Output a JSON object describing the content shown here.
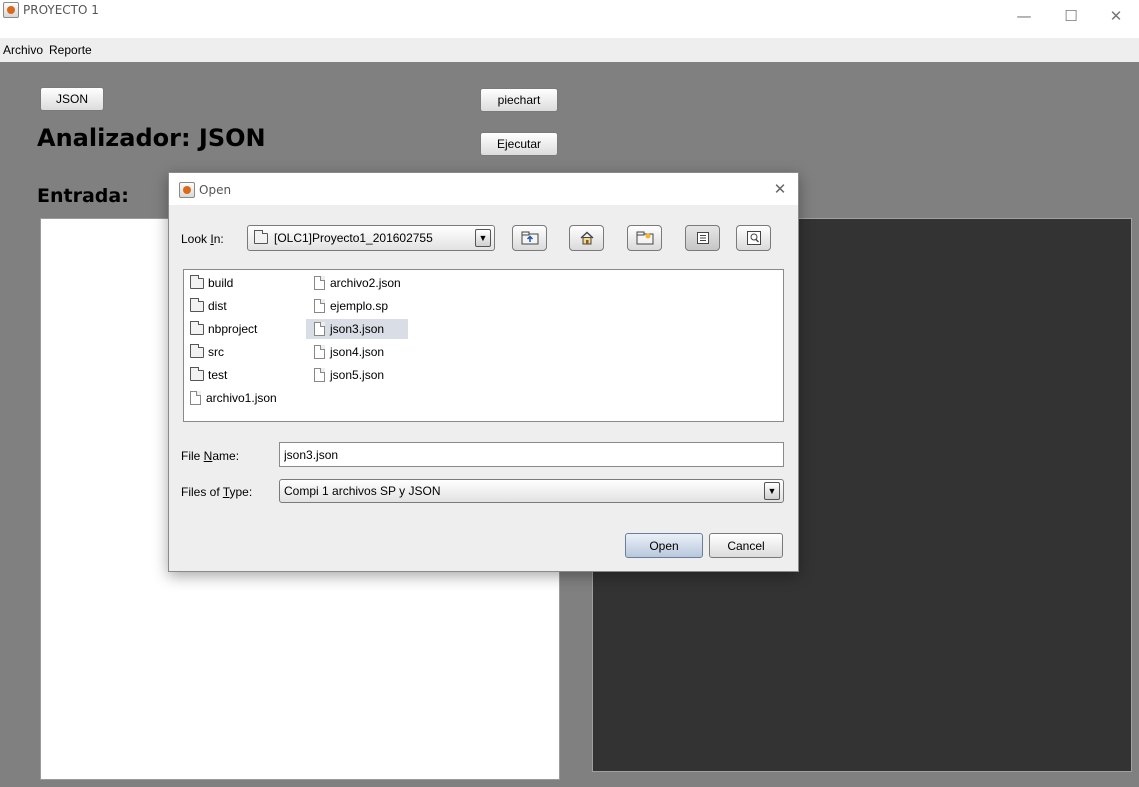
{
  "window": {
    "title": "PROYECTO 1",
    "controls": {
      "minimize": "—",
      "maximize": "☐",
      "close": "✕"
    }
  },
  "menubar": {
    "items": [
      {
        "label": "Archivo"
      },
      {
        "label": "Reporte"
      }
    ]
  },
  "main": {
    "json_button": "JSON",
    "piechart_button": "piechart",
    "execute_button": "Ejecutar",
    "analyzer_label": "Analizador: JSON",
    "input_label": "Entrada:"
  },
  "dialog": {
    "title": "Open",
    "close": "✕",
    "look_in": {
      "label_pre": "Look ",
      "label_mnemonic": "I",
      "label_post": "n:",
      "value": "[OLC1]Proyecto1_201602755"
    },
    "files": [
      {
        "name": "build",
        "kind": "folder"
      },
      {
        "name": "dist",
        "kind": "folder"
      },
      {
        "name": "nbproject",
        "kind": "folder"
      },
      {
        "name": "src",
        "kind": "folder"
      },
      {
        "name": "test",
        "kind": "folder"
      },
      {
        "name": "archivo1.json",
        "kind": "file"
      },
      {
        "name": "archivo2.json",
        "kind": "file"
      },
      {
        "name": "ejemplo.sp",
        "kind": "file"
      },
      {
        "name": "json3.json",
        "kind": "file",
        "selected": true
      },
      {
        "name": "json4.json",
        "kind": "file"
      },
      {
        "name": "json5.json",
        "kind": "file"
      }
    ],
    "file_name": {
      "label_pre": "File ",
      "label_mnemonic": "N",
      "label_post": "ame:",
      "value": "json3.json"
    },
    "file_type": {
      "label_pre": "Files of ",
      "label_mnemonic": "T",
      "label_post": "ype:",
      "value": "Compi 1 archivos SP y JSON"
    },
    "open_button": "Open",
    "cancel_button": "Cancel"
  }
}
